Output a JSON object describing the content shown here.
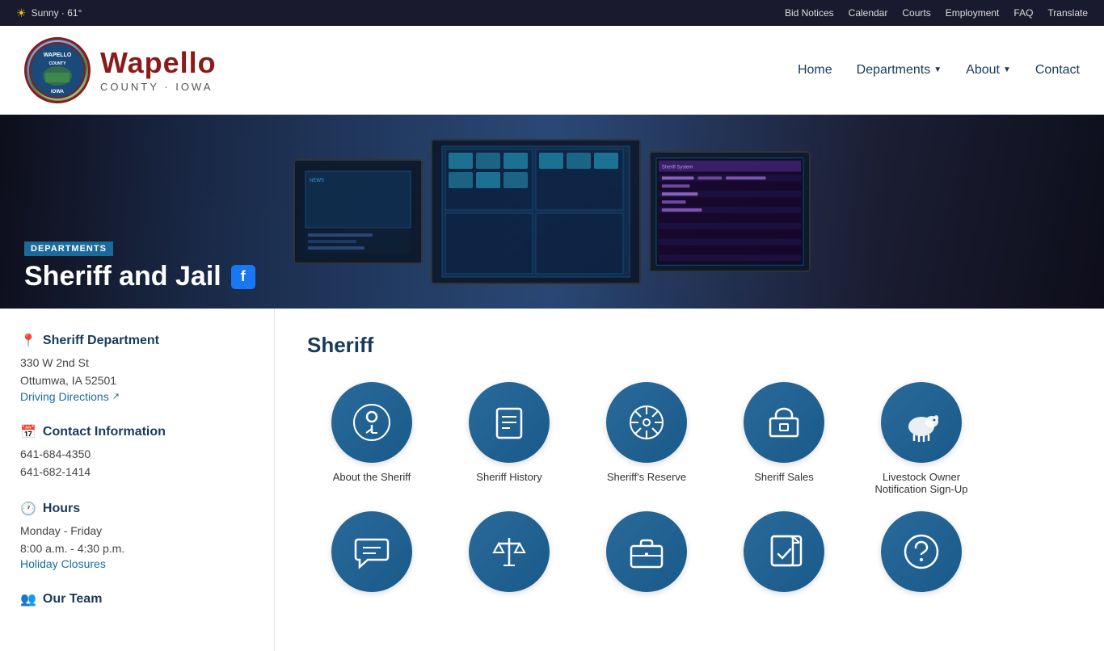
{
  "topbar": {
    "weather": "Sunny · 61°",
    "links": [
      {
        "label": "Bid Notices",
        "name": "bid-notices-link"
      },
      {
        "label": "Calendar",
        "name": "calendar-link"
      },
      {
        "label": "Courts",
        "name": "courts-link"
      },
      {
        "label": "Employment",
        "name": "employment-link"
      },
      {
        "label": "FAQ",
        "name": "faq-link"
      },
      {
        "label": "Translate",
        "name": "translate-link"
      }
    ]
  },
  "nav": {
    "county_name": "Wapello",
    "county_sub": "COUNTY · IOWA",
    "links": [
      {
        "label": "Home",
        "name": "home-nav"
      },
      {
        "label": "Departments",
        "name": "departments-nav",
        "dropdown": true
      },
      {
        "label": "About",
        "name": "about-nav",
        "dropdown": true
      },
      {
        "label": "Contact",
        "name": "contact-nav"
      }
    ]
  },
  "hero": {
    "badge": "DEPARTMENTS",
    "title": "Sheriff and Jail"
  },
  "sidebar": {
    "dept_name": "Sheriff Department",
    "address_line1": "330 W 2nd St",
    "address_line2": "Ottumwa, IA 52501",
    "driving_directions": "Driving Directions",
    "contact_title": "Contact Information",
    "phone1": "641-684-4350",
    "phone2": "641-682-1414",
    "hours_title": "Hours",
    "hours_days": "Monday - Friday",
    "hours_time": "8:00 a.m. - 4:30 p.m.",
    "holiday_closures": "Holiday Closures",
    "our_team": "Our Team"
  },
  "main": {
    "section_title": "Sheriff",
    "icon_rows": [
      [
        {
          "icon": "ℹ",
          "label": "About the Sheriff",
          "name": "about-sheriff-card"
        },
        {
          "icon": "📋",
          "label": "Sheriff History",
          "name": "sheriff-history-card"
        },
        {
          "icon": "✳",
          "label": "Sheriff's Reserve",
          "name": "sheriffs-reserve-card"
        },
        {
          "icon": "🏠",
          "label": "Sheriff Sales",
          "name": "sheriff-sales-card"
        },
        {
          "icon": "🐑",
          "label": "Livestock Owner Notification Sign-Up",
          "name": "livestock-card"
        }
      ],
      [
        {
          "icon": "💬",
          "label": "",
          "name": "chat-card"
        },
        {
          "icon": "⚖",
          "label": "",
          "name": "scales-card"
        },
        {
          "icon": "💼",
          "label": "",
          "name": "briefcase-card"
        },
        {
          "icon": "📄",
          "label": "",
          "name": "document-card"
        },
        {
          "icon": "❓",
          "label": "",
          "name": "question-card"
        }
      ]
    ]
  }
}
